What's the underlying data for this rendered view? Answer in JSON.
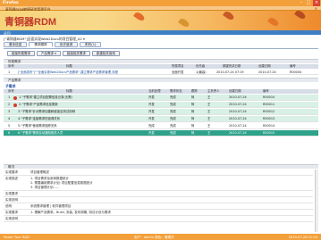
{
  "window": {
    "title": "青铜器RDM敏捷研发管理平台"
  },
  "site": {
    "title": "Firefox"
  },
  "brand": {
    "logo": "青铜器RDM"
  },
  "nav": {
    "label": "返回"
  },
  "breadcrumb": "[\"青铜器RDM\"]全面实现Web2Docs的项目管理_A2 ▾",
  "tabs": [
    "基本信息",
    "需求跟踪",
    "历史追溯",
    "附件(1)"
  ],
  "toolbar": [
    "链接所属需求",
    "产品需求 ▾",
    "链接相关需求",
    "新建相关用例"
  ],
  "parent": {
    "section": "所属需求",
    "headers": [
      "序号",
      "标题",
      "所属项目",
      "优先级",
      "期望完成日期",
      "创建日期",
      "编号"
    ],
    "rows": [
      {
        "no": "1",
        "title": "[\"全面发布\"]\"\"全面实现Web2Docs产品需求\",建立需求产品需求管理,流程",
        "project": "全面开发",
        "priority": "1(最高)",
        "expect": "2010-07-24 07:19",
        "created": "2010-07-24",
        "code": "R00004"
      }
    ]
  },
  "sub": {
    "section": "产品需求",
    "title": "子需求",
    "headers": [
      "序号",
      "标题",
      "当前处理",
      "需求状态",
      "跟踪",
      "主负责人",
      "创建日期",
      "编号"
    ],
    "rows": [
      {
        "no": "1",
        "title": "1.\"子需求\"建立项目配置信息记录(无需)",
        "handler": "开发",
        "status": "完成",
        "track": "阿",
        "owner": "王",
        "created": "2010-07-24",
        "code": "R00010",
        "flag": "red",
        "style": "lgreen"
      },
      {
        "no": "2",
        "title": "2.\"子需求\"产品需求信息更新",
        "handler": "开发",
        "status": "完成",
        "track": "阿",
        "owner": "王",
        "created": "2010-07-24",
        "code": "R00011",
        "flag": "red",
        "style": "lgreen"
      },
      {
        "no": "3",
        "title": "3.\"子需求\"针对需求创建和链接至测试用例",
        "handler": "开发",
        "status": "完成",
        "track": "阿",
        "owner": "王",
        "created": "2010-07-24",
        "code": "R00012",
        "flag": "",
        "style": "lgreen"
      },
      {
        "no": "4",
        "title": "4.\"子需求\"连接需求的追溯关系",
        "handler": "开发",
        "status": "完成",
        "track": "阿",
        "owner": "王",
        "created": "2010-07-24",
        "code": "R00013",
        "flag": "",
        "style": "lgreen"
      },
      {
        "no": "5",
        "title": "5.\"子需求\"使用需求追踪关系",
        "handler": "完成",
        "status": "完成",
        "track": "阿",
        "owner": "王",
        "created": "2010-07-24",
        "code": "R00014",
        "flag": "",
        "style": "white"
      },
      {
        "no": "6",
        "title": "6.\"子需求\"需求自动通知相关人员",
        "handler": "开发",
        "status": "完成",
        "track": "阿",
        "owner": "王",
        "created": "2010-07-24",
        "code": "R00015",
        "flag": "",
        "style": "green"
      }
    ]
  },
  "detail": {
    "section": "概况",
    "items": [
      {
        "label": "实现要求",
        "value": "项目管理概述"
      },
      {
        "label": "实现描述",
        "value": "1. 项目需求及用例数据统计\n2. 需要编制需求计划; 项目配置信息数据统计\n3. 项目管理计划……"
      },
      {
        "label": "实现要求",
        "value": ""
      },
      {
        "label": "实现说明",
        "value": ""
      },
      {
        "label": "说明",
        "value": "系统需求管理 | 软件管理项目"
      },
      {
        "label": "实现要求",
        "value": "1. 理解产品需求。Build, 安装, 发布周期, 测试计划与需求"
      },
      {
        "label": "实现说明",
        "value": ""
      }
    ]
  },
  "footer": {
    "left": "Power Your R&D",
    "center": "用户：admin 角色：管理员",
    "right": "2010-07-26 21:50"
  }
}
